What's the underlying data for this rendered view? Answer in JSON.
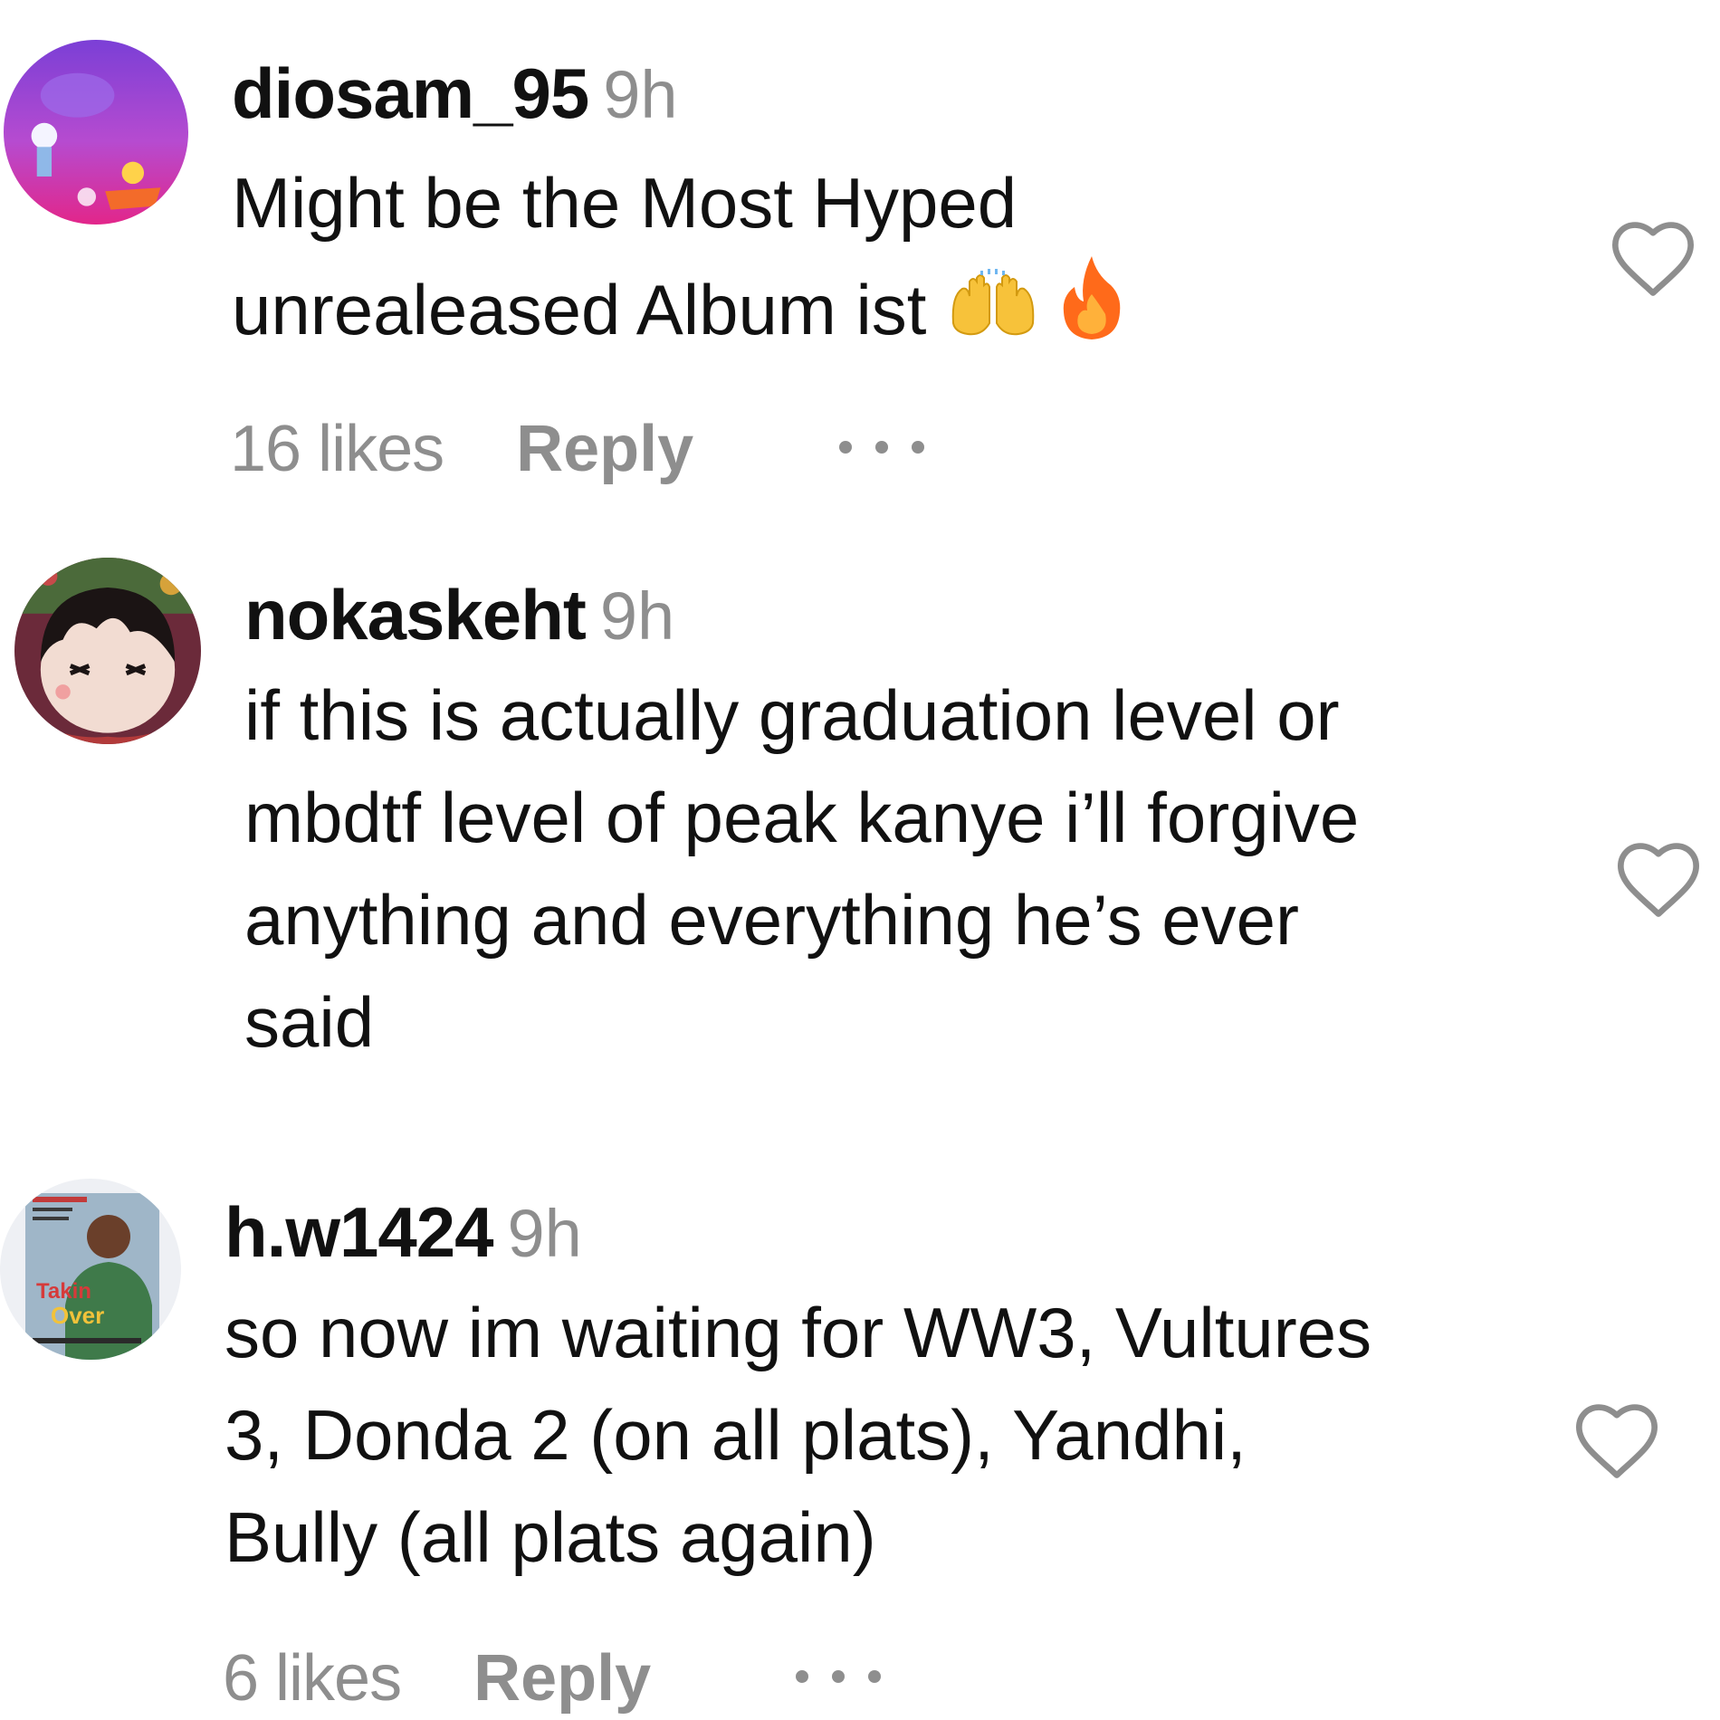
{
  "comments": [
    {
      "username": "diosam_95",
      "time": "9h",
      "lines": [
        "Might be the Most Hyped",
        "unrealeased Album ist"
      ],
      "emojis": [
        "raising-hands-emoji",
        "fire-emoji"
      ],
      "likes": "16 likes",
      "reply": "Reply"
    },
    {
      "username": "nokaskeht",
      "time": "9h",
      "lines": [
        "if this is actually graduation level or",
        "mbdtf level of peak kanye i’ll forgive",
        "anything and everything he’s ever",
        "said"
      ]
    },
    {
      "username": "h.w1424",
      "time": "9h",
      "lines": [
        "so now im waiting for WW3, Vultures",
        "3, Donda 2 (on all plats), Yandhi,",
        "Bully (all plats again)"
      ],
      "likes": "6 likes",
      "reply": "Reply"
    }
  ],
  "colors": {
    "text": "#111111",
    "muted": "#8e8e8e",
    "background": "#ffffff"
  },
  "icons": {
    "like": "heart-outline-icon",
    "more": "more-options-icon"
  }
}
